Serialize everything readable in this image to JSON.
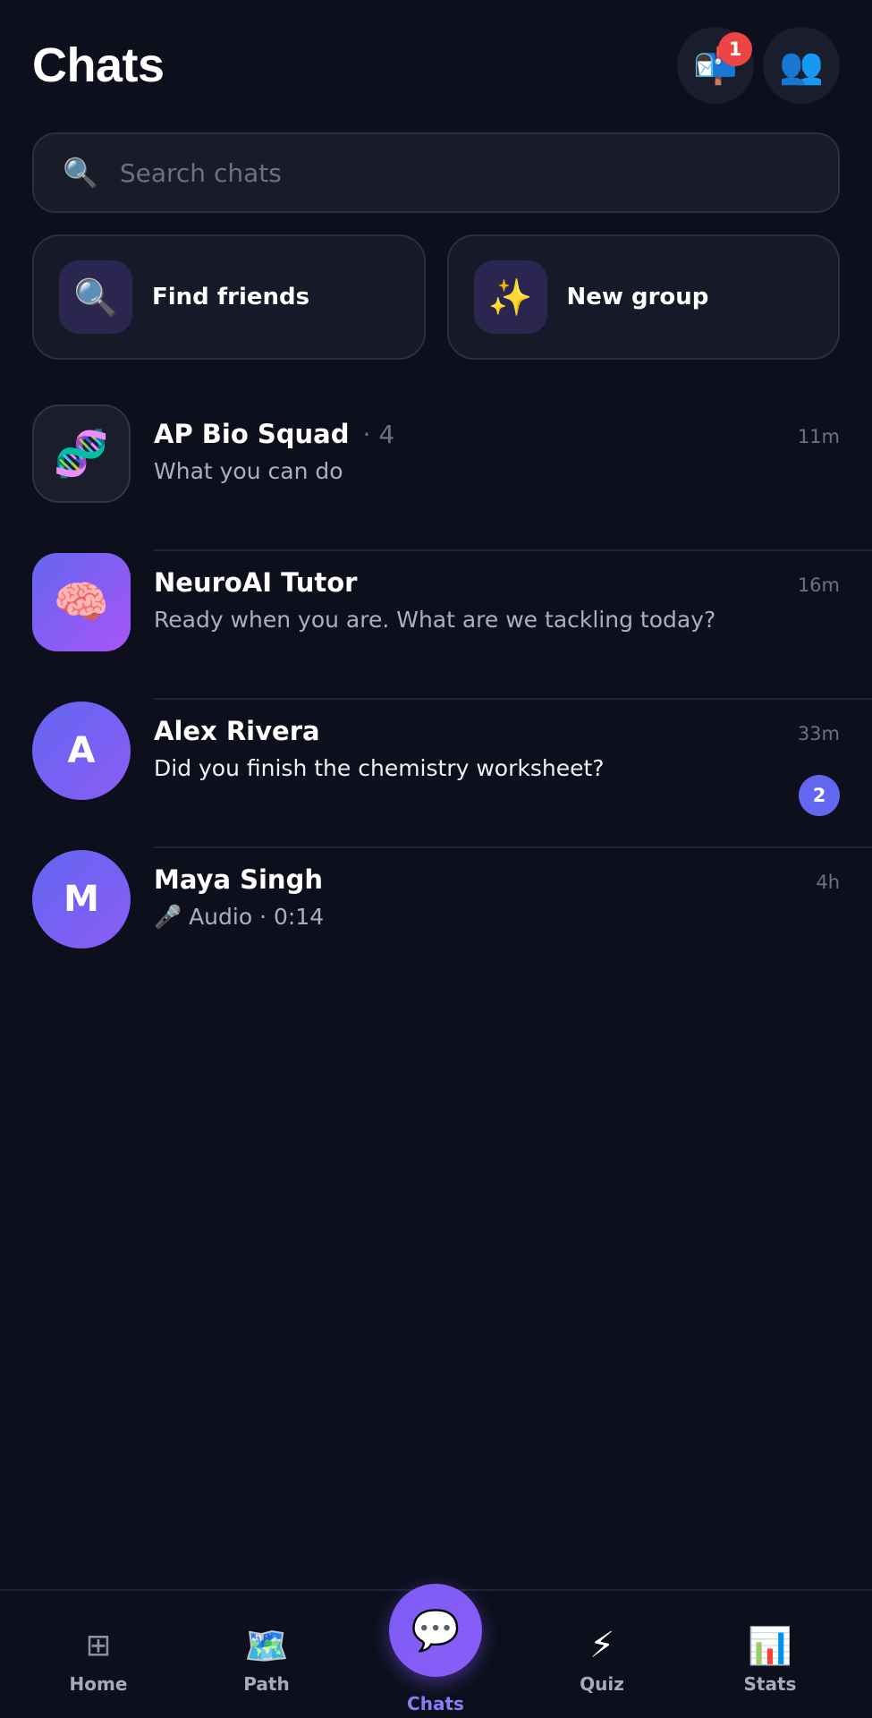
{
  "header": {
    "title": "Chats",
    "inbox_icon": "📬",
    "inbox_badge": "1",
    "friends_icon": "👥"
  },
  "search": {
    "icon": "🔍",
    "placeholder": "Search chats",
    "value": ""
  },
  "quick_actions": [
    {
      "icon": "🔍",
      "label": "Find friends"
    },
    {
      "icon": "✨",
      "label": "New group"
    }
  ],
  "chats": [
    {
      "name": "AP Bio Squad",
      "members": "· 4",
      "preview": "What you can do",
      "time": "11m",
      "avatar": "🧬"
    },
    {
      "name": "NeuroAI Tutor",
      "preview": "Ready when you are. What are we tackling today?",
      "time": "16m",
      "avatar": "🧠"
    },
    {
      "name": "Alex Rivera",
      "preview": "Did you finish the chemistry worksheet?",
      "time": "33m",
      "avatar": "A",
      "unread": "2"
    },
    {
      "name": "Maya Singh",
      "preview": "🎤 Audio · 0:14",
      "time": "4h",
      "avatar": "M"
    }
  ],
  "nav": {
    "home": {
      "icon": "⊞",
      "label": "Home"
    },
    "path": {
      "icon": "🗺️",
      "label": "Path"
    },
    "chats": {
      "icon": "💬",
      "label": "Chats"
    },
    "quiz": {
      "icon": "⚡",
      "label": "Quiz"
    },
    "stats": {
      "icon": "📊",
      "label": "Stats"
    }
  },
  "colors": {
    "background": "#0d0f1d",
    "accent": "#6366f1",
    "badge": "#ef4444"
  }
}
